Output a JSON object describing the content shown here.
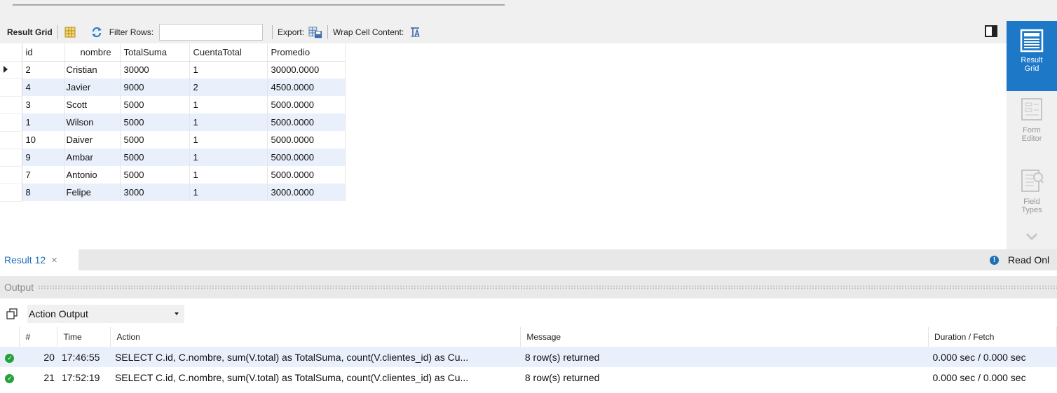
{
  "toolbar": {
    "result_grid_label": "Result Grid",
    "filter_rows_label": "Filter Rows:",
    "filter_value": "",
    "export_label": "Export:",
    "wrap_label": "Wrap Cell Content:"
  },
  "grid": {
    "columns": [
      "id",
      "nombre",
      "TotalSuma",
      "CuentaTotal",
      "Promedio"
    ],
    "rows": [
      [
        "2",
        "Cristian",
        "30000",
        "1",
        "30000.0000"
      ],
      [
        "4",
        "Javier",
        "9000",
        "2",
        "4500.0000"
      ],
      [
        "3",
        "Scott",
        "5000",
        "1",
        "5000.0000"
      ],
      [
        "1",
        "Wilson",
        "5000",
        "1",
        "5000.0000"
      ],
      [
        "10",
        "Daiver",
        "5000",
        "1",
        "5000.0000"
      ],
      [
        "9",
        "Ambar",
        "5000",
        "1",
        "5000.0000"
      ],
      [
        "7",
        "Antonio",
        "5000",
        "1",
        "5000.0000"
      ],
      [
        "8",
        "Felipe",
        "3000",
        "1",
        "3000.0000"
      ]
    ]
  },
  "side_panel": {
    "result_grid": "Result Grid",
    "form_editor": "Form Editor",
    "field_types": "Field Types"
  },
  "result_tab": {
    "label": "Result 12",
    "close": "×"
  },
  "read_only": "Read Onl",
  "output": {
    "label": "Output",
    "selector": "Action Output",
    "columns": {
      "num": "#",
      "time": "Time",
      "action": "Action",
      "message": "Message",
      "duration": "Duration / Fetch"
    },
    "rows": [
      {
        "num": "20",
        "time": "17:46:55",
        "action": "SELECT C.id, C.nombre, sum(V.total) as TotalSuma, count(V.clientes_id) as Cu...",
        "message": "8 row(s) returned",
        "duration": "0.000 sec / 0.000 sec"
      },
      {
        "num": "21",
        "time": "17:52:19",
        "action": "SELECT C.id, C.nombre, sum(V.total) as TotalSuma, count(V.clientes_id) as Cu...",
        "message": "8 row(s) returned",
        "duration": "0.000 sec / 0.000 sec"
      }
    ]
  },
  "colors": {
    "accent": "#1e78c8",
    "row_alt": "#e9f0fb",
    "success": "#22a33a"
  }
}
